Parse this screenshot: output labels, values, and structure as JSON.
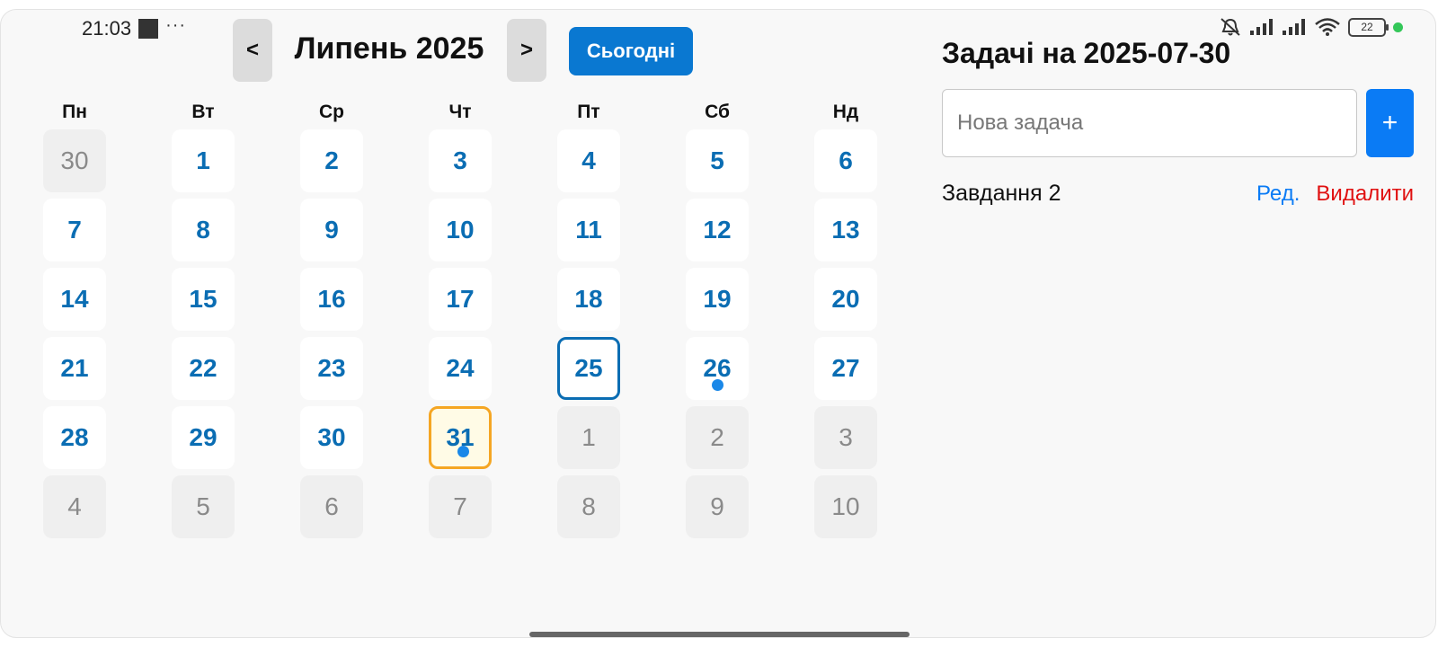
{
  "status_bar": {
    "time": "21:03",
    "more": "···",
    "battery": "22",
    "icons": [
      "stop-icon",
      "bell-muted-icon",
      "signal-icon",
      "signal-icon",
      "wifi-icon",
      "battery-icon",
      "green-dot-icon"
    ]
  },
  "calendar": {
    "prev_label": "<",
    "next_label": ">",
    "month_title": "Липень 2025",
    "today_label": "Сьогодні",
    "weekdays": [
      "Пн",
      "Вт",
      "Ср",
      "Чт",
      "Пт",
      "Сб",
      "Нд"
    ],
    "days": [
      {
        "label": "30",
        "other": true
      },
      {
        "label": "1"
      },
      {
        "label": "2"
      },
      {
        "label": "3"
      },
      {
        "label": "4"
      },
      {
        "label": "5"
      },
      {
        "label": "6"
      },
      {
        "label": "7"
      },
      {
        "label": "8"
      },
      {
        "label": "9"
      },
      {
        "label": "10"
      },
      {
        "label": "11"
      },
      {
        "label": "12"
      },
      {
        "label": "13"
      },
      {
        "label": "14"
      },
      {
        "label": "15"
      },
      {
        "label": "16"
      },
      {
        "label": "17"
      },
      {
        "label": "18"
      },
      {
        "label": "19"
      },
      {
        "label": "20"
      },
      {
        "label": "21"
      },
      {
        "label": "22"
      },
      {
        "label": "23"
      },
      {
        "label": "24"
      },
      {
        "label": "25",
        "selected": true
      },
      {
        "label": "26",
        "has_tasks": true
      },
      {
        "label": "27"
      },
      {
        "label": "28"
      },
      {
        "label": "29"
      },
      {
        "label": "30"
      },
      {
        "label": "31",
        "today": true,
        "has_tasks": true
      },
      {
        "label": "1",
        "other": true
      },
      {
        "label": "2",
        "other": true
      },
      {
        "label": "3",
        "other": true
      },
      {
        "label": "4",
        "other": true
      },
      {
        "label": "5",
        "other": true
      },
      {
        "label": "6",
        "other": true
      },
      {
        "label": "7",
        "other": true
      },
      {
        "label": "8",
        "other": true
      },
      {
        "label": "9",
        "other": true
      },
      {
        "label": "10",
        "other": true
      }
    ]
  },
  "tasks": {
    "title": "Задачі на 2025-07-30",
    "input_placeholder": "Нова задача",
    "input_value": "",
    "add_label": "+",
    "items": [
      {
        "text": "Завдання 2",
        "edit_label": "Ред.",
        "delete_label": "Видалити"
      }
    ]
  },
  "colors": {
    "accent": "#0a6db3",
    "today_border": "#f5a623",
    "dot": "#1a88e8",
    "delete": "#e01010"
  }
}
